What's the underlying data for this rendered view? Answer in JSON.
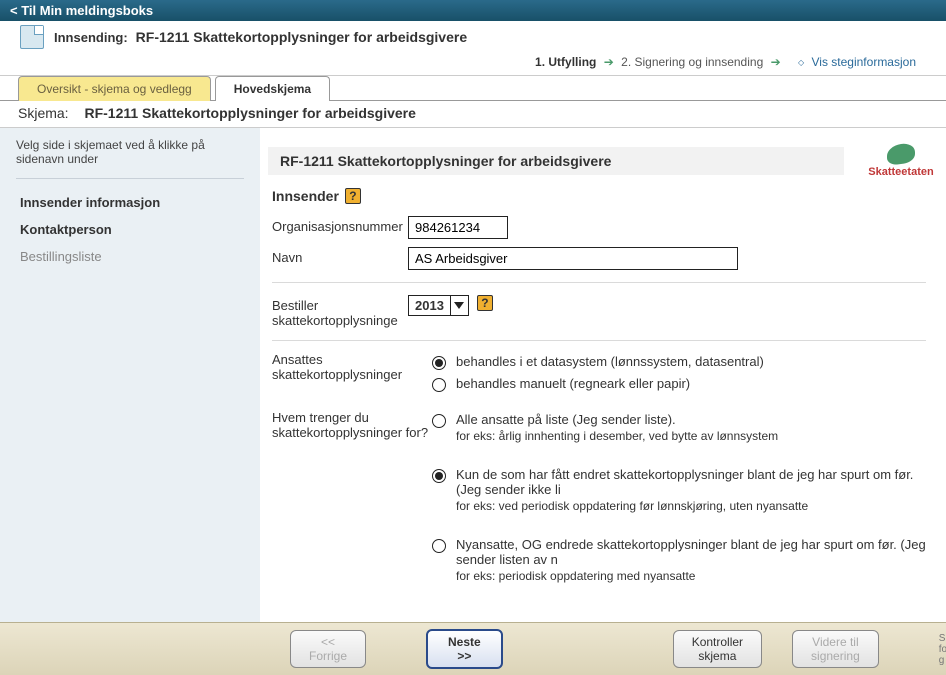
{
  "topbar": {
    "back_label": "< Til Min meldingsboks"
  },
  "header": {
    "label": "Innsending:",
    "title": "RF-1211 Skattekortopplysninger for arbeidsgivere"
  },
  "steps": {
    "step1": "1. Utfylling",
    "step2": "2. Signering og innsending",
    "info_link": "Vis steginformasjon"
  },
  "tabs": {
    "overview": "Oversikt - skjema og vedlegg",
    "main": "Hovedskjema"
  },
  "skjema_row": {
    "label": "Skjema:",
    "value": "RF-1211 Skattekortopplysninger for arbeidsgivere"
  },
  "sidebar": {
    "hint": "Velg side i skjemaet ved å klikke på sidenavn under",
    "items": [
      "Innsender informasjon",
      "Kontaktperson",
      "Bestillingsliste"
    ]
  },
  "form": {
    "title": "RF-1211 Skattekortopplysninger for arbeidsgivere",
    "logo_label": "Skatteetaten",
    "section_innsender": "Innsender",
    "orgnr_label": "Organisasjonsnummer",
    "orgnr_value": "984261234",
    "navn_label": "Navn",
    "navn_value": "AS Arbeidsgiver",
    "bestiller_label": "Bestiller skattekortopplysninge",
    "year_value": "2013",
    "ansattes_label": "Ansattes skattekortopplysninger",
    "ansattes_opts": [
      "behandles i et datasystem (lønnssystem, datasentral)",
      "behandles manuelt (regneark eller papir)"
    ],
    "hvem_label": "Hvem trenger du skattekortopplysninger for?",
    "hvem_opts": [
      {
        "title": "Alle ansatte på liste (Jeg sender liste).",
        "sub": "for eks: årlig innhenting i desember, ved bytte av lønnsystem"
      },
      {
        "title": "Kun de som har fått endret skattekortopplysninger blant de jeg har spurt om før.  (Jeg sender ikke li",
        "sub": "for eks: ved periodisk oppdatering før lønnskjøring, uten nyansatte"
      },
      {
        "title": "Nyansatte, OG endrede skattekortopplysninger blant de jeg har spurt om før. (Jeg sender listen av n",
        "sub": "for eks: periodisk oppdatering med nyansatte"
      }
    ]
  },
  "footer": {
    "prev": "<< Forrige",
    "next": "Neste >>",
    "check": "Kontroller skjema",
    "sign": "Videre til signering",
    "note1": "Skjem",
    "note2": "for å g"
  }
}
